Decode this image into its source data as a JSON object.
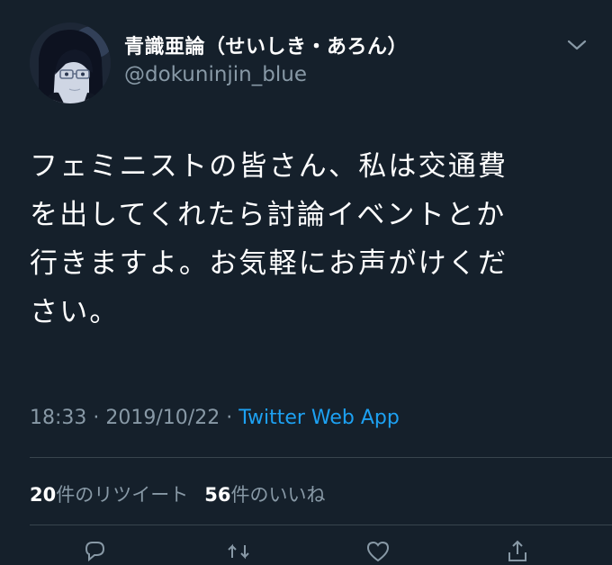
{
  "author": {
    "display_name": "青識亜論（せいしき・あろん）",
    "handle": "@dokuninjin_blue"
  },
  "tweet": {
    "lines": [
      "フェミニストの皆さん、私は交通費",
      "を出してくれたら討論イベントとか",
      "行きますよ。お気軽にお声がけくだ",
      "さい。"
    ],
    "time": "18:33",
    "separator": " · ",
    "date": "2019/10/22",
    "source": "Twitter Web App"
  },
  "stats": {
    "retweet_count": "20",
    "retweet_label": "件のリツイート",
    "like_count": "56",
    "like_label": "件のいいね"
  },
  "icons": {
    "menu": "chevron-down-icon",
    "reply": "reply-icon",
    "retweet": "retweet-icon",
    "like": "heart-icon",
    "share": "share-icon"
  },
  "colors": {
    "background": "#15202b",
    "text": "#ffffff",
    "muted": "#8899a6",
    "accent": "#1da1f2",
    "divider": "#38444d"
  }
}
